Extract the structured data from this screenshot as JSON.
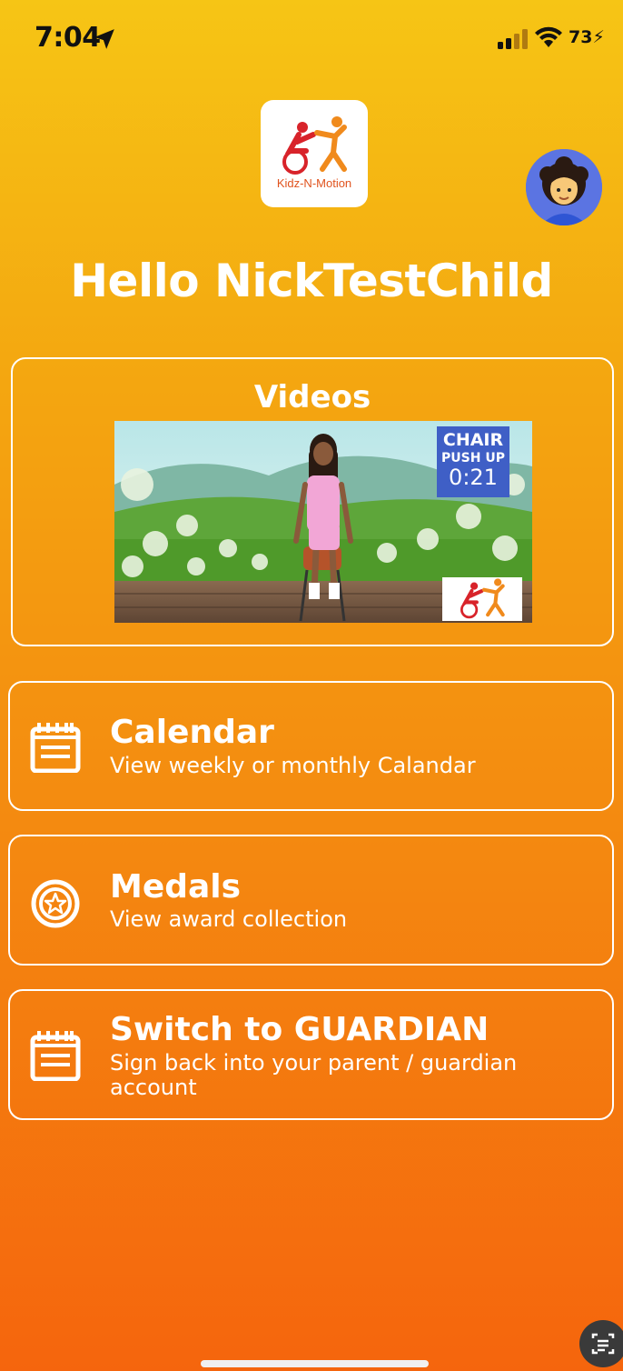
{
  "status_bar": {
    "time": "7:04",
    "battery": "73"
  },
  "header": {
    "logo_text": "Kidz-N-Motion",
    "greeting": "Hello NickTestChild"
  },
  "videos": {
    "title": "Videos",
    "thumbnail": {
      "line1": "CHAIR",
      "line2": "PUSH UP",
      "duration": "0:21"
    }
  },
  "menu": [
    {
      "title": "Calendar",
      "subtitle": "View weekly or monthly Calandar",
      "icon": "calendar-icon"
    },
    {
      "title": "Medals",
      "subtitle": "View award collection",
      "icon": "medal-star-icon"
    },
    {
      "title": "Switch to GUARDIAN",
      "subtitle": "Sign back into your parent / guardian account",
      "icon": "calendar-icon"
    }
  ]
}
